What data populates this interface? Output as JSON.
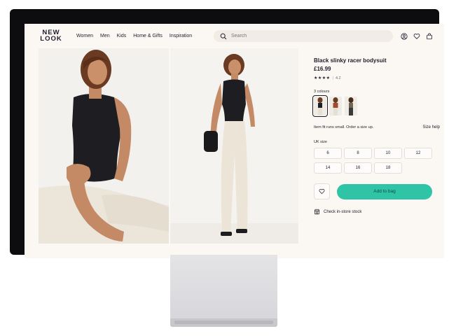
{
  "header": {
    "logo_line1": "NEW",
    "logo_line2": "LOOK",
    "nav": [
      "Women",
      "Men",
      "Kids",
      "Home & Gifts",
      "Inspiration"
    ],
    "search_placeholder": "Search"
  },
  "product": {
    "title": "Black slinky racer bodysuit",
    "price": "£16.99",
    "stars": "★★★★",
    "rating": "4.2",
    "colours_label": "3 colours",
    "fit_note": "Item fit runs small. Order a size up.",
    "size_help": "Size help",
    "size_label": "UK size",
    "sizes": [
      "6",
      "8",
      "10",
      "12",
      "14",
      "16",
      "18"
    ],
    "add_to_bag": "Add to bag",
    "check_stock": "Check in-store stock"
  },
  "colors": {
    "accent": "#2ec4a5",
    "frame": "#0d0d10",
    "screen_bg": "#fbf8f3"
  }
}
